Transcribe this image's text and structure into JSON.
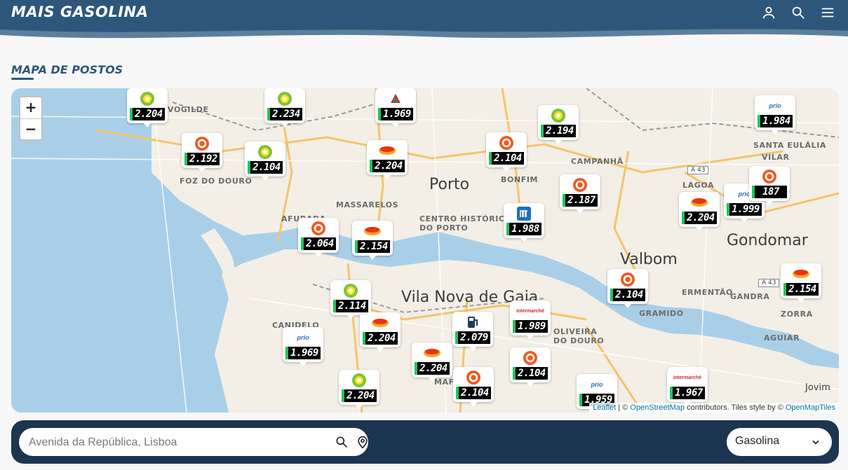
{
  "header": {
    "logo": "MAIS GASOLINA",
    "icons": [
      "user-icon",
      "search-icon",
      "menu-icon"
    ]
  },
  "section": {
    "title": "MAPA DE POSTOS"
  },
  "colors": {
    "header": "#2e567a",
    "bar": "#1c3550",
    "price_accent": "#22c55e",
    "water": "#a9cfe8"
  },
  "map": {
    "zoom_in": "+",
    "zoom_out": "−",
    "places": [
      "NEVOGILDE",
      "FOZ DO DOURO",
      "CAMPANHÃ",
      "BONFIM",
      "CENTRO HISTÓRICO",
      "DO PORTO",
      "AFURADA",
      "CANIDELO",
      "MAFAMUDE",
      "OLIVEIRA",
      "DO DOURO",
      "LAGOA",
      "SANTA EULÁLIA",
      "VILAR",
      "ERMENTÃO",
      "GRAMIDO",
      "GANDRA",
      "ZORRA",
      "AGUIAR",
      "MASSARELOS"
    ],
    "cities": [
      "Porto",
      "Valbom",
      "Gondomar",
      "Vila Nova de Gaia",
      "Jovim"
    ],
    "roads": [
      "A 43",
      "A 43"
    ],
    "markers": [
      {
        "brand": "galp",
        "price": "2.192"
      },
      {
        "brand": "bp",
        "price": "2.104"
      },
      {
        "brand": "bp",
        "price": "2.234"
      },
      {
        "brand": "repsol",
        "price": "2.204"
      },
      {
        "brand": "galp",
        "price": "2.104"
      },
      {
        "brand": "bp",
        "price": "2.194"
      },
      {
        "brand": "galp",
        "price": "2.187"
      },
      {
        "brand": "moeve",
        "price": "1.988"
      },
      {
        "brand": "galp",
        "price": "2.064"
      },
      {
        "brand": "repsol",
        "price": "2.154"
      },
      {
        "brand": "bp",
        "price": "2.114"
      },
      {
        "brand": "repsol",
        "price": "2.204"
      },
      {
        "brand": "pump",
        "price": "2.079"
      },
      {
        "brand": "intermarche",
        "price": "1.989"
      },
      {
        "brand": "prio",
        "price": "1.969"
      },
      {
        "brand": "repsol",
        "price": "2.204"
      },
      {
        "brand": "galp",
        "price": "2.104"
      },
      {
        "brand": "bp",
        "price": "2.204"
      },
      {
        "brand": "repsol",
        "price": "2.204"
      },
      {
        "brand": "prio",
        "price": "1.999"
      },
      {
        "brand": "galp",
        "price": "2.104"
      },
      {
        "brand": "repsol",
        "price": "2.154"
      },
      {
        "brand": "intermarche",
        "price": "1.967"
      },
      {
        "brand": "prio",
        "price": "1.984"
      },
      {
        "brand": "galp",
        "price": "187"
      },
      {
        "brand": "alves-bandeira",
        "price": "1.969"
      },
      {
        "brand": "prio",
        "price": "1.959"
      },
      {
        "brand": "galp",
        "price": "2.104"
      },
      {
        "brand": "bp",
        "price": "2.204"
      }
    ],
    "attribution": {
      "leaflet": "Leaflet",
      "sep": " | © ",
      "osm": "OpenStreetMap",
      "middle": " contributors. Tiles style by © ",
      "omt": "OpenMapTiles"
    }
  },
  "search": {
    "placeholder": "Avenida da República, Lisboa",
    "icons": [
      "search-icon",
      "location-pin-icon"
    ]
  },
  "fuel_select": {
    "value": "Gasolina"
  }
}
